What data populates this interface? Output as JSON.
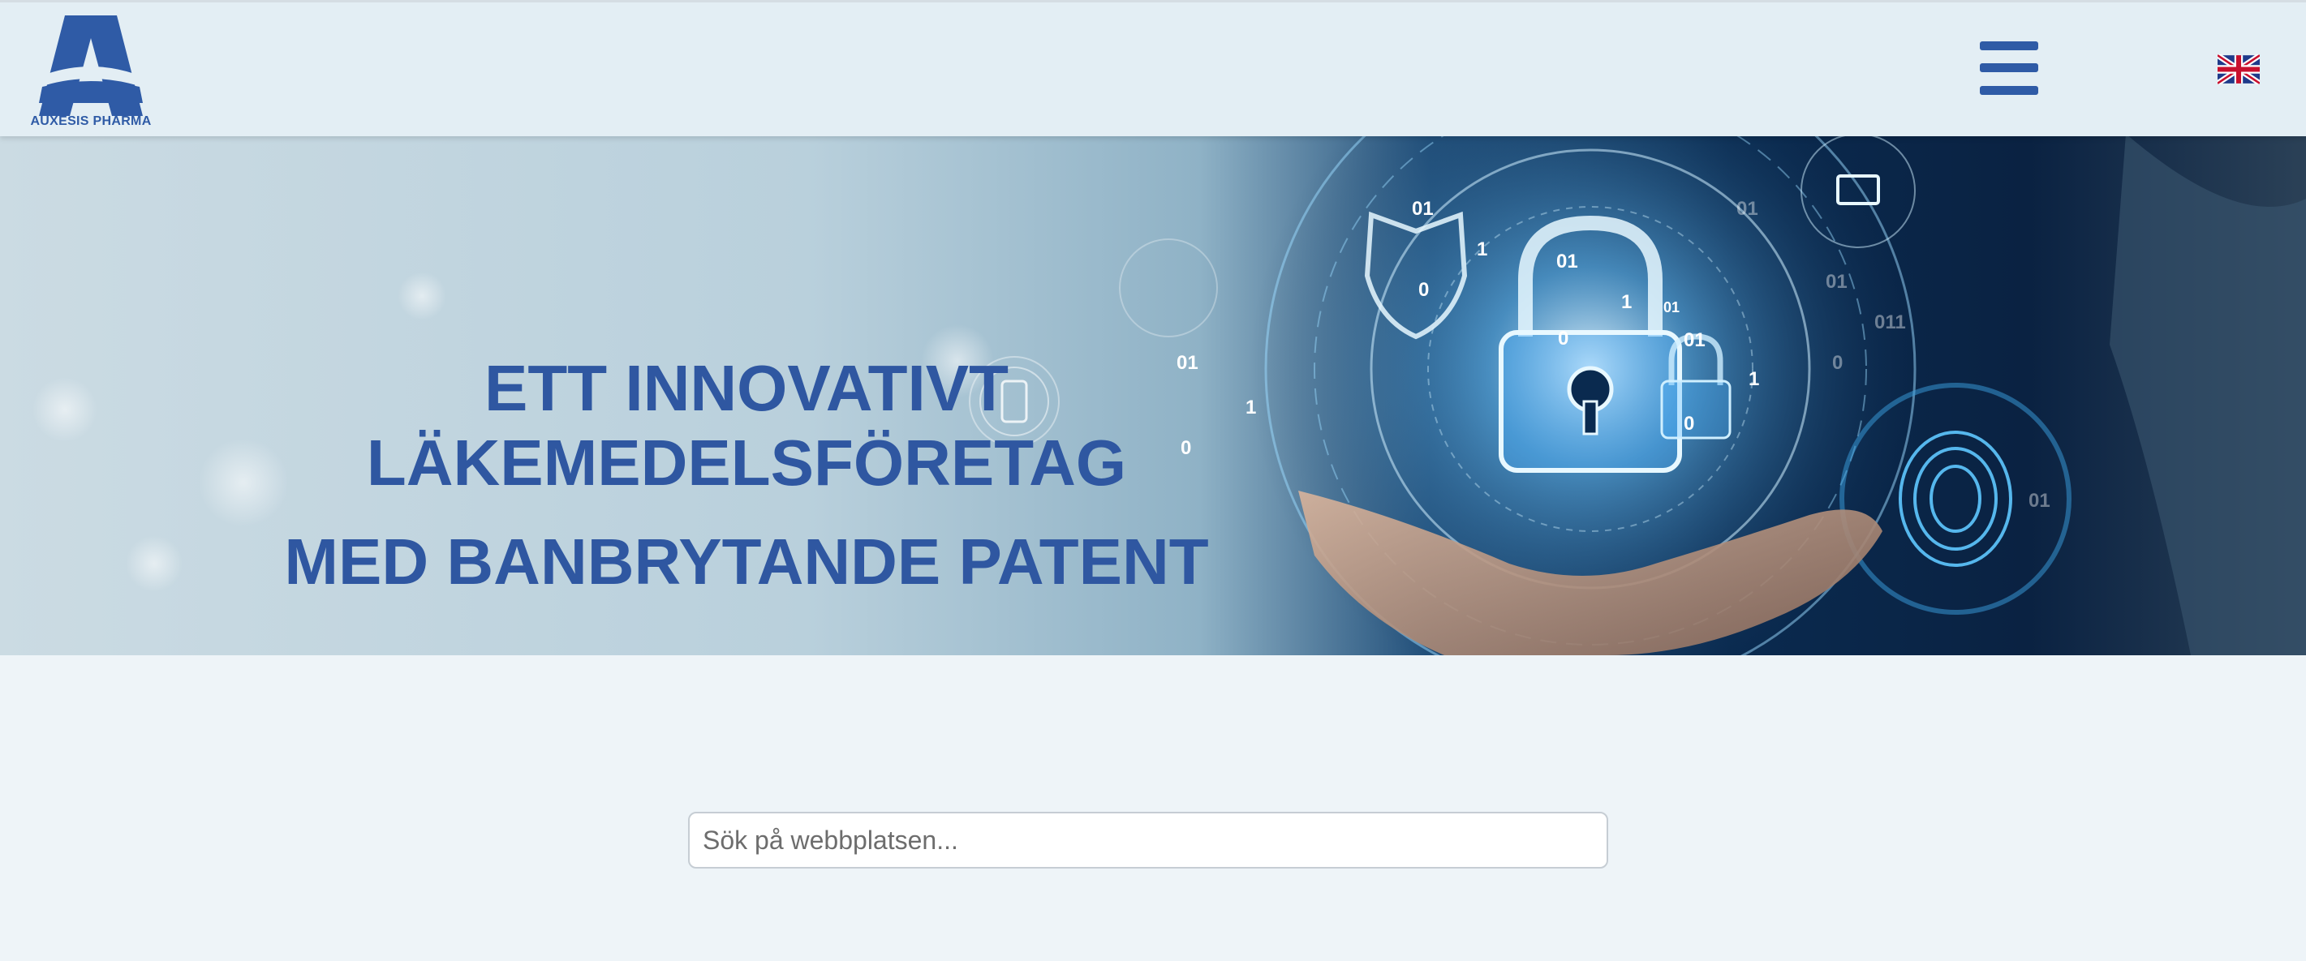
{
  "header": {
    "logo_text": "AUXESIS PHARMA",
    "menu_icon": "hamburger-menu-icon",
    "language_icon": "uk-flag-icon"
  },
  "hero": {
    "line1": "ETT INNOVATIVT",
    "line2": "LÄKEMEDELSFÖRETAG",
    "line3": "MED BANBRYTANDE PATENT",
    "image_labels": [
      "01",
      "01",
      "1",
      "01",
      "1",
      "01",
      "01",
      "0",
      "0",
      "1",
      "0",
      "01",
      "1",
      "0",
      "01",
      "011",
      "01",
      "0",
      "01"
    ]
  },
  "search": {
    "placeholder": "Sök på webbplatsen...",
    "value": ""
  },
  "colors": {
    "brand_blue": "#2f5ba6",
    "header_bg": "#e3eef4",
    "page_bg": "#eef4f8"
  }
}
